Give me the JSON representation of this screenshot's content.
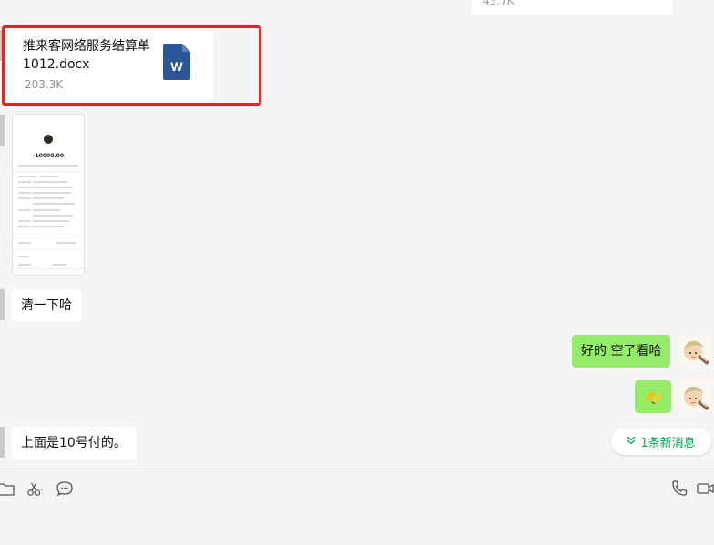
{
  "chat": {
    "top_partial": {
      "file_size": "43.7K"
    },
    "file_message": {
      "file_name": "推来客网络服务结算单1012.docx",
      "file_size": "203.3K",
      "icon": "word-document-icon",
      "highlight_color": "#d92a2a"
    },
    "image_message": {
      "type": "payment-receipt-screenshot",
      "amount": "-10000.00"
    },
    "messages": [
      {
        "side": "left",
        "text": "清一下哈"
      },
      {
        "side": "right",
        "text": "好的 空了看哈"
      },
      {
        "side": "right",
        "emoji": "banana-emoji"
      },
      {
        "side": "left",
        "text": "上面是10号付的。"
      }
    ],
    "new_messages_pill": {
      "label": "1条新消息",
      "icon": "double-chevron-down-icon"
    }
  },
  "toolbar": {
    "left_icons": [
      "folder-icon",
      "scissors-icon",
      "chat-bubble-icon"
    ],
    "right_icons": [
      "phone-icon",
      "video-icon"
    ]
  },
  "colors": {
    "background": "#f5f5f5",
    "bubble_self": "#95ec69",
    "bubble_other": "#ffffff",
    "accent_green": "#07a85a",
    "highlight_red": "#d92a2a"
  }
}
